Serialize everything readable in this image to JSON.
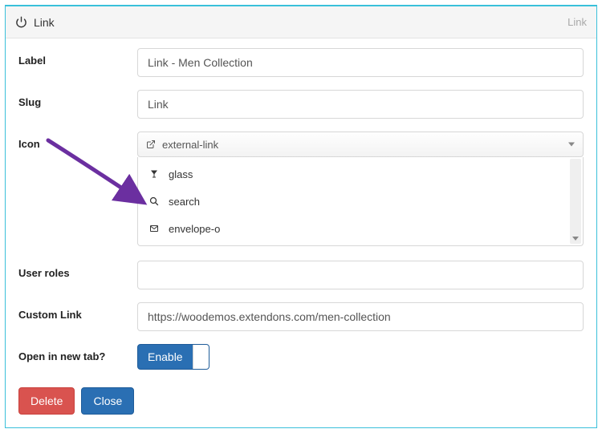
{
  "header": {
    "title": "Link",
    "link_text": "Link"
  },
  "labels": {
    "label": "Label",
    "slug": "Slug",
    "icon": "Icon",
    "user_roles": "User roles",
    "custom_link": "Custom Link",
    "open_new_tab": "Open in new tab?"
  },
  "fields": {
    "label_value": "Link - Men Collection",
    "slug_value": "Link",
    "icon_selected": "external-link",
    "icon_dropdown": [
      {
        "name": "glass",
        "icon": "glass-icon"
      },
      {
        "name": "search",
        "icon": "search-icon"
      },
      {
        "name": "envelope-o",
        "icon": "envelope-icon"
      }
    ],
    "user_roles_value": "",
    "custom_link_value": "https://woodemos.extendons.com/men-collection",
    "open_new_tab_label": "Enable"
  },
  "buttons": {
    "delete": "Delete",
    "close": "Close"
  },
  "colors": {
    "panel_border": "#3ac0da",
    "primary": "#2a6fb3",
    "danger": "#d9534f",
    "arrow": "#6b2fa0"
  }
}
